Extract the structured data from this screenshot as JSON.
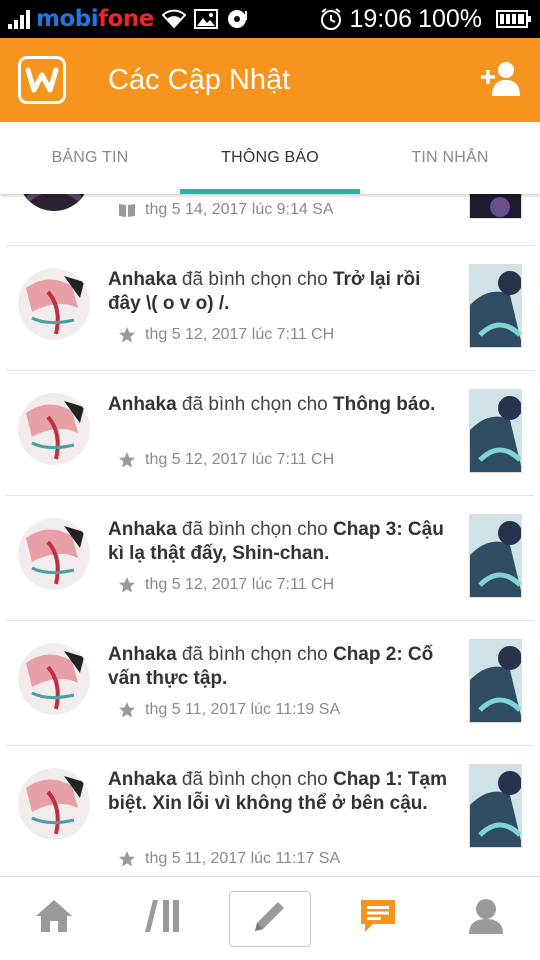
{
  "status_bar": {
    "carrier_a": "mobi",
    "carrier_b": "fone",
    "time": "19:06",
    "battery": "100%"
  },
  "app_bar": {
    "title": "Các Cập Nhật",
    "logo_icon": "wattpad-logo-icon",
    "action_icon": "add-friend-icon"
  },
  "tabs": [
    {
      "label": "BẢNG TIN",
      "active": false
    },
    {
      "label": "THÔNG BÁO",
      "active": true
    },
    {
      "label": "TIN NHẮN",
      "active": false
    }
  ],
  "notifications": [
    {
      "user": "",
      "verb": "",
      "story": "",
      "time": "thg 5 14, 2017 lúc 9:14 SA",
      "icon": "book-icon"
    },
    {
      "user": "Anhaka",
      "verb": " đã bình chọn cho ",
      "story": "Trở lại rồi đây \\( o v o) /.",
      "time": "thg 5 12, 2017 lúc 7:11 CH",
      "icon": "star-icon"
    },
    {
      "user": "Anhaka",
      "verb": " đã bình chọn cho ",
      "story": "Thông báo.",
      "time": "thg 5 12, 2017 lúc 7:11 CH",
      "icon": "star-icon"
    },
    {
      "user": "Anhaka",
      "verb": " đã bình chọn cho ",
      "story": "Chap 3: Cậu kì lạ thật đấy, Shin-chan.",
      "time": "thg 5 12, 2017 lúc 7:11 CH",
      "icon": "star-icon"
    },
    {
      "user": "Anhaka",
      "verb": " đã bình chọn cho ",
      "story": "Chap 2: Cố vấn thực tập.",
      "time": "thg 5 11, 2017 lúc 11:19 SA",
      "icon": "star-icon"
    },
    {
      "user": "Anhaka",
      "verb": " đã bình chọn cho ",
      "story": "Chap 1: Tạm biệt. Xin lỗi vì không thể ở bên cậu.",
      "time": "thg 5 11, 2017 lúc 11:17 SA",
      "icon": "star-icon"
    }
  ],
  "bottom_nav": [
    {
      "icon": "home-icon",
      "active": false
    },
    {
      "icon": "library-icon",
      "active": false
    },
    {
      "icon": "pencil-icon",
      "active": false
    },
    {
      "icon": "messages-icon",
      "active": true
    },
    {
      "icon": "profile-icon",
      "active": false
    }
  ],
  "colors": {
    "app_bar": "#f7941d",
    "tab_indicator": "#1fb5ad",
    "nav_active": "#f7941d",
    "nav_inactive": "#9a9a9a"
  }
}
